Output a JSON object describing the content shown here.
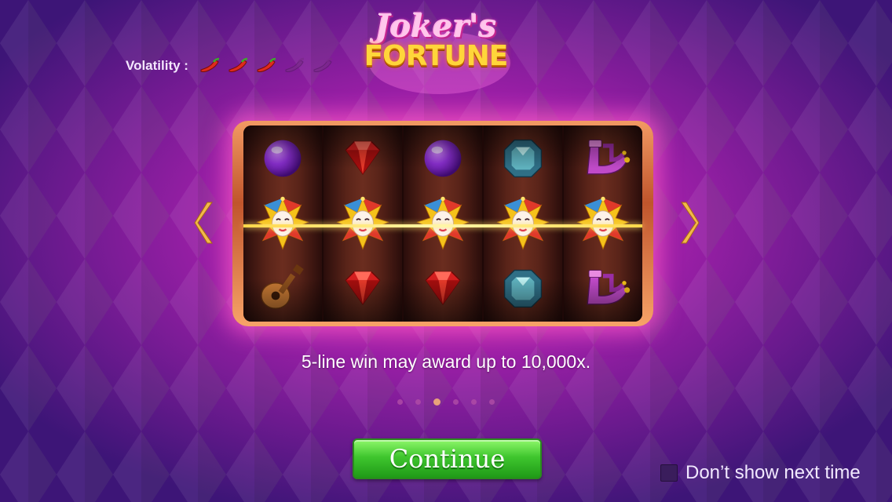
{
  "game": {
    "logo_script": "Joker's",
    "logo_main": "FORTUNE"
  },
  "volatility": {
    "label": "Volatility :",
    "level": 3,
    "max": 5
  },
  "reels": [
    [
      "purple-orb",
      "joker-mask",
      "lute"
    ],
    [
      "red-gem",
      "joker-mask",
      "red-gem"
    ],
    [
      "purple-orb",
      "joker-mask",
      "red-gem"
    ],
    [
      "blue-gem",
      "joker-mask",
      "blue-gem"
    ],
    [
      "jester-boots",
      "joker-mask",
      "jester-boots"
    ]
  ],
  "caption": "5-line win may award up to 10,000x.",
  "pagination": {
    "count": 6,
    "active_index": 2
  },
  "continue_label": "Continue",
  "dont_show_label": "Don’t show next time",
  "colors": {
    "background": "#5a1a8a",
    "glow": "#ff3fc0",
    "button_green": "#3fc62e"
  }
}
